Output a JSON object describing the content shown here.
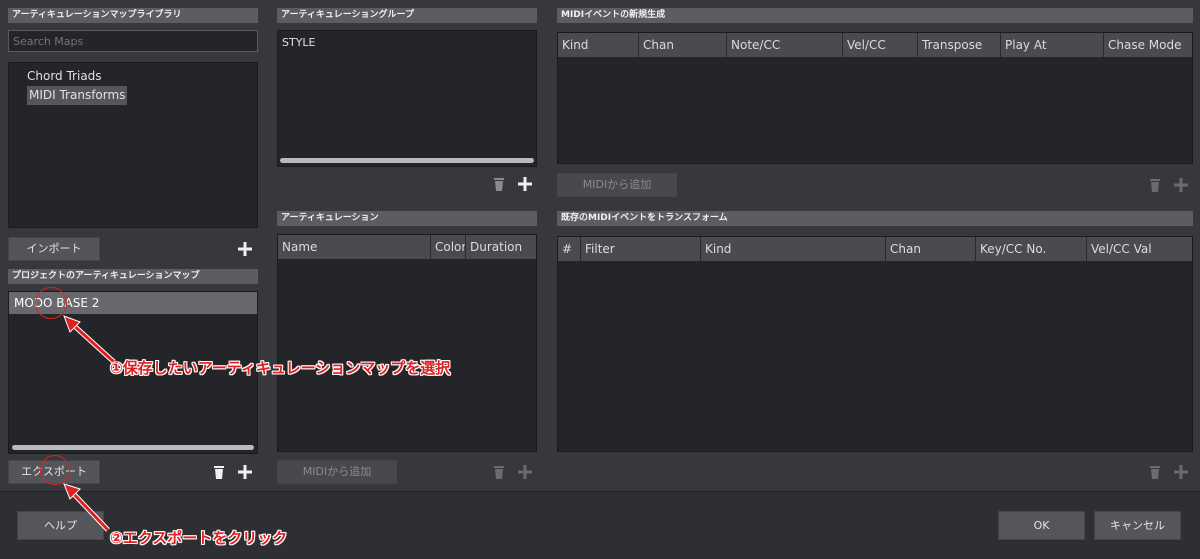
{
  "library": {
    "header": "アーティキュレーションマップライブラリ",
    "search_placeholder": "Search Maps",
    "items": [
      {
        "label": "Chord Triads"
      },
      {
        "label": "MIDI Transforms"
      }
    ],
    "import_label": "インポート"
  },
  "project_maps": {
    "header": "プロジェクトのアーティキュレーションマップ",
    "items": [
      {
        "label": "MODO BASE 2"
      }
    ],
    "export_label": "エクスポート"
  },
  "groups": {
    "header": "アーティキュレーショングループ",
    "items": [
      {
        "label": "STYLE"
      }
    ]
  },
  "articulations": {
    "header": "アーティキュレーション",
    "columns": [
      "Name",
      "Color",
      "Duration"
    ],
    "add_from_midi_label": "MIDIから追加"
  },
  "midi_new": {
    "header": "MIDIイベントの新規生成",
    "columns": [
      "Kind",
      "Chan",
      "Note/CC",
      "Vel/CC",
      "Transpose",
      "Play At",
      "Chase Mode"
    ],
    "add_from_midi_label": "MIDIから追加"
  },
  "midi_transform": {
    "header": "既存のMIDIイベントをトランスフォーム",
    "columns": [
      "#",
      "Filter",
      "Kind",
      "Chan",
      "Key/CC No.",
      "Vel/CC Val"
    ]
  },
  "footer": {
    "help_label": "ヘルプ",
    "ok_label": "OK",
    "cancel_label": "キャンセル"
  },
  "annotations": {
    "step1": "①保存したいアーティキュレーションマップを選択",
    "step2": "②エクスポートをクリック",
    "color": "#e02020"
  },
  "icons": {
    "trash": "trash-icon",
    "plus": "plus-icon"
  }
}
